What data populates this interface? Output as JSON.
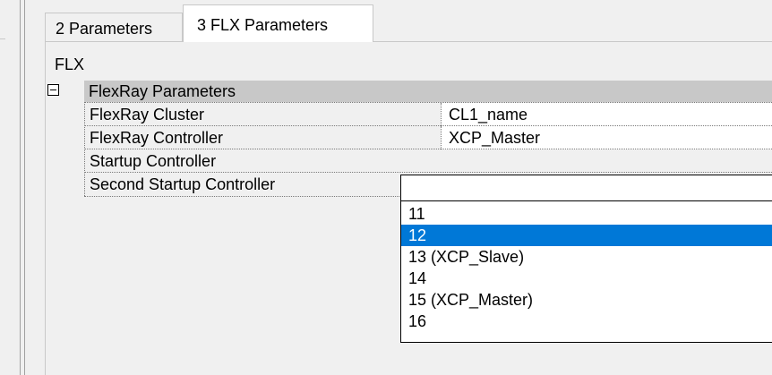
{
  "tabs": [
    {
      "label": "2 Parameters",
      "active": false
    },
    {
      "label": "3 FLX Parameters",
      "active": true
    }
  ],
  "panel": {
    "title": "FLX"
  },
  "grid": {
    "category": "FlexRay Parameters",
    "rows": [
      {
        "name": "FlexRay Cluster",
        "value": "CL1_name"
      },
      {
        "name": "FlexRay Controller",
        "value": "XCP_Master"
      },
      {
        "name": "Startup Controller",
        "value": ""
      },
      {
        "name": "Second Startup Controller",
        "value": ""
      }
    ]
  },
  "dropdown": {
    "selected_value": "12",
    "options": [
      "11",
      "12",
      "13 (XCP_Slave)",
      "14",
      "15 (XCP_Master)",
      "16"
    ]
  },
  "colors": {
    "selection": "#0078d7",
    "category_bg": "#c8c8c8",
    "window_bg": "#f0f0f0"
  }
}
